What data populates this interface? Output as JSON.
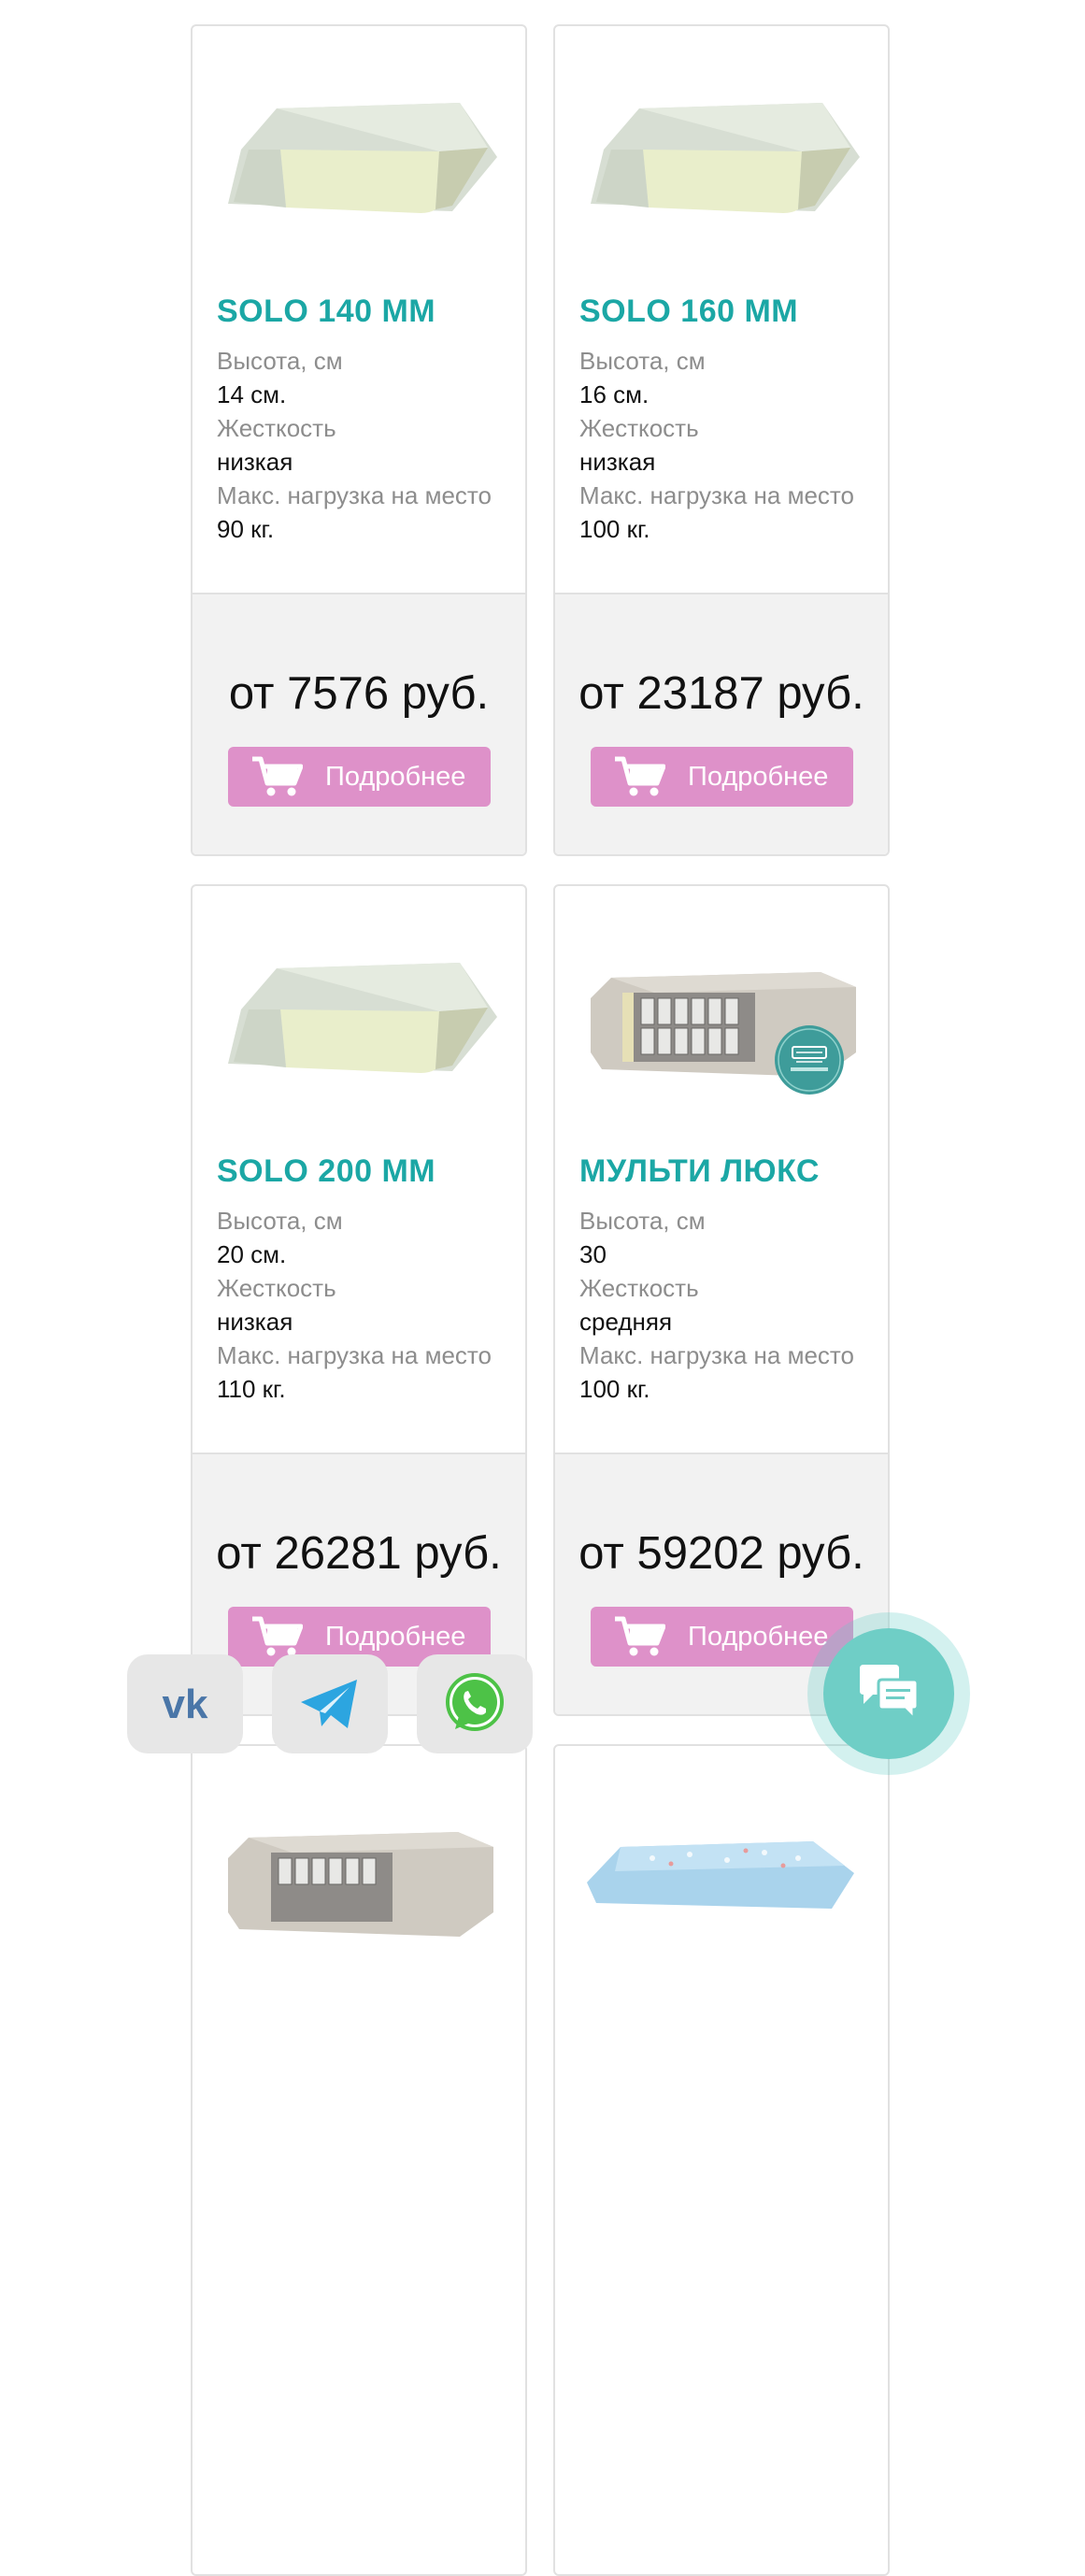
{
  "labels": {
    "height": "Высота, см",
    "hardness": "Жесткость",
    "max_load": "Макс. нагрузка на место"
  },
  "button_label": "Подробнее",
  "products": [
    {
      "title": "SOLO 140 MM",
      "height": "14 см.",
      "hardness": "низкая",
      "max_load": "90 кг.",
      "price": "от 7576 руб."
    },
    {
      "title": "SOLO 160 MM",
      "height": "16 см.",
      "hardness": "низкая",
      "max_load": "100 кг.",
      "price": "от 23187 руб."
    },
    {
      "title": "SOLO 200 MM",
      "height": "20 см.",
      "hardness": "низкая",
      "max_load": "110 кг.",
      "price": "от 26281 руб."
    },
    {
      "title": "МУЛЬТИ ЛЮКС",
      "height": "30",
      "hardness": "средняя",
      "max_load": "100 кг.",
      "price": "от 59202 руб."
    }
  ],
  "social": [
    {
      "icon": "vk-icon",
      "label": "VK"
    },
    {
      "icon": "telegram-icon",
      "label": "Telegram"
    },
    {
      "icon": "whatsapp-icon",
      "label": "WhatsApp"
    }
  ],
  "icons": {
    "cart": "cart-icon",
    "chat": "chat-bubbles-icon",
    "badge": "double-sided-badge-icon"
  },
  "colors": {
    "title": "#1ba7a5",
    "button": "#de91c9",
    "chat": "#6fcec6",
    "label": "#8d8d8d",
    "vk": "#4a76a8",
    "telegram": "#2ca5e0",
    "whatsapp": "#4dc247"
  }
}
